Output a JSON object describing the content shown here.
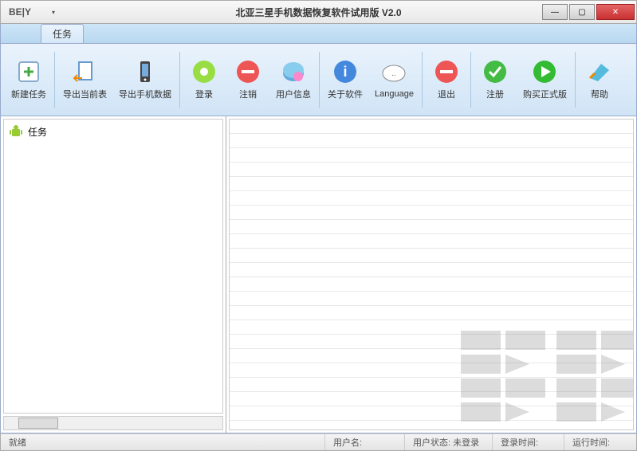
{
  "window": {
    "title": "北亚三星手机数据恢复软件试用版 V2.0",
    "logo_text": "BE|Y"
  },
  "ribbon": {
    "tab": "任务",
    "buttons": {
      "new_task": "新建任务",
      "export_table": "导出当前表",
      "export_phone": "导出手机数据",
      "login": "登录",
      "logout": "注销",
      "user_info": "用户信息",
      "about": "关于软件",
      "language": "Language",
      "exit": "退出",
      "register": "注册",
      "buy": "购买正式版",
      "help": "帮助"
    }
  },
  "tree": {
    "root": "任务"
  },
  "statusbar": {
    "ready": "就绪",
    "user_label": "用户名:",
    "user_status_label": "用户状态:",
    "user_status_value": "未登录",
    "login_time_label": "登录时间:",
    "run_time_label": "运行时间:"
  }
}
